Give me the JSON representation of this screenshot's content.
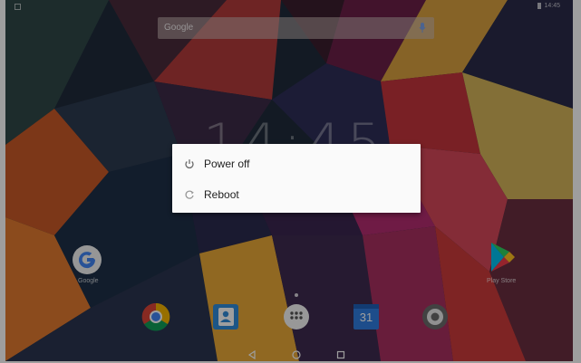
{
  "status_bar": {
    "time": "14:45"
  },
  "search": {
    "brand": "Google",
    "mic_icon": "mic-icon"
  },
  "clock": {
    "time": "14:45"
  },
  "power_menu": {
    "items": [
      {
        "label": "Power off",
        "icon": "power-icon"
      },
      {
        "label": "Reboot",
        "icon": "reboot-icon"
      }
    ]
  },
  "desktop": {
    "apps": [
      {
        "label": "Google",
        "icon": "google-g-icon"
      },
      {
        "label": "Play Store",
        "icon": "play-store-icon"
      }
    ]
  },
  "dock": {
    "apps": [
      {
        "icon": "chrome-icon"
      },
      {
        "icon": "contacts-icon"
      },
      {
        "icon": "app-drawer-icon"
      },
      {
        "icon": "calendar-icon",
        "text": "31"
      },
      {
        "icon": "settings-icon"
      }
    ]
  },
  "nav": {
    "back": "back-icon",
    "home": "home-icon",
    "recents": "recents-icon"
  },
  "colors": {
    "dialog_bg": "#fafafa",
    "text": "#222222",
    "icon": "#6b6b6b"
  }
}
